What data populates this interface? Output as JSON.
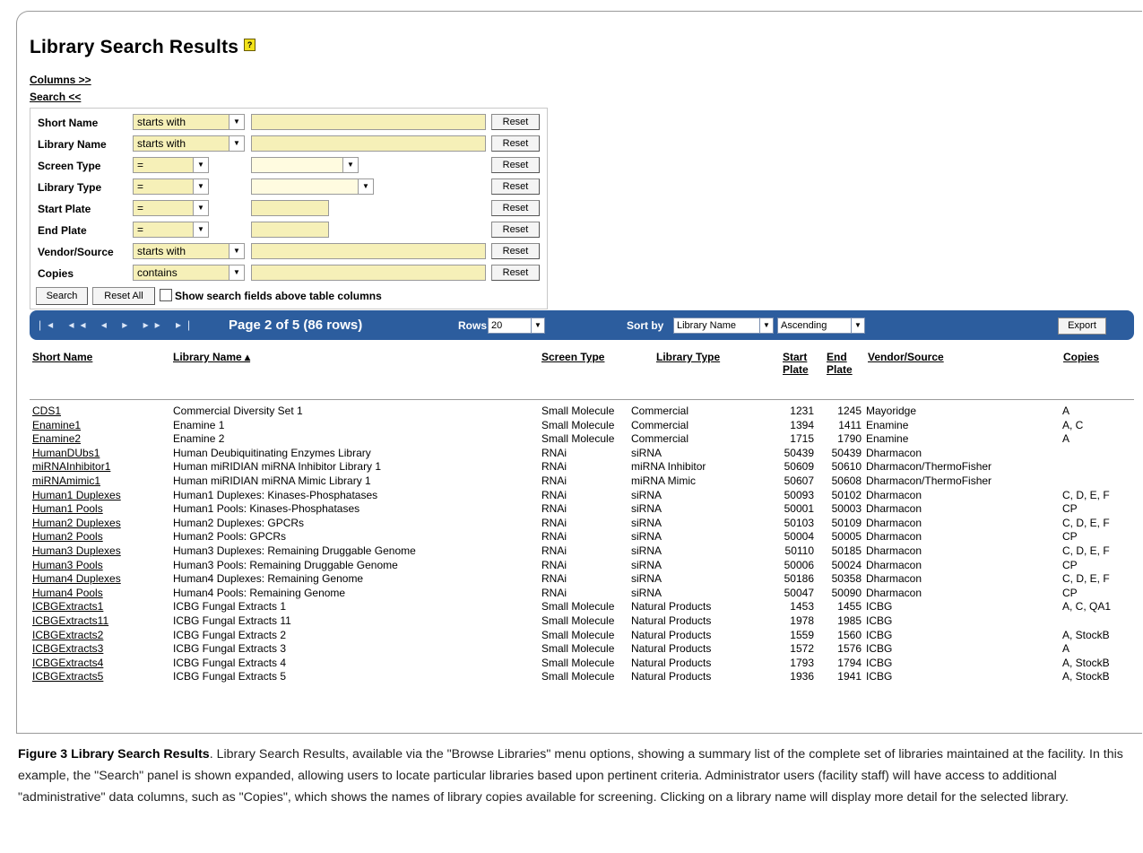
{
  "title": "Library Search Results",
  "help_icon": "help-icon",
  "columns_toggle": "Columns >>",
  "search_toggle": "Search <<",
  "search_fields": [
    {
      "label": "Short Name",
      "operator": "starts with",
      "value": "",
      "reset": "Reset"
    },
    {
      "label": "Library Name",
      "operator": "starts with",
      "value": "",
      "reset": "Reset"
    },
    {
      "label": "Screen Type",
      "operator": "=",
      "value": "",
      "reset": "Reset"
    },
    {
      "label": "Library Type",
      "operator": "=",
      "value": "",
      "reset": "Reset"
    },
    {
      "label": "Start Plate",
      "operator": "=",
      "value": "",
      "reset": "Reset"
    },
    {
      "label": "End Plate",
      "operator": "=",
      "value": "",
      "reset": "Reset"
    },
    {
      "label": "Vendor/Source",
      "operator": "starts with",
      "value": "",
      "reset": "Reset"
    },
    {
      "label": "Copies",
      "operator": "contains",
      "value": "",
      "reset": "Reset"
    }
  ],
  "search_button": "Search",
  "reset_all_button": "Reset All",
  "show_fields_label": "Show search fields above table columns",
  "navbar": {
    "nav_icons": "first, fast-back, back, forward, fast-forward, last",
    "page_info": "Page 2 of 5 (86 rows)",
    "rows_label": "Rows",
    "rows_value": "20",
    "sort_label": "Sort by",
    "sort_field": "Library Name",
    "sort_order": "Ascending",
    "export": "Export"
  },
  "headers": {
    "short_name": "Short Name",
    "library_name": "Library Name ▴",
    "screen_type": "Screen Type",
    "library_type": "Library Type",
    "start_plate_1": "Start",
    "start_plate_2": "Plate",
    "end_plate_1": "End",
    "end_plate_2": "Plate",
    "vendor": "Vendor/Source",
    "copies": "Copies"
  },
  "rows": [
    [
      "CDS1",
      "Commercial Diversity Set 1",
      "Small Molecule",
      "Commercial",
      "1231",
      "1245",
      "Mayoridge",
      "A"
    ],
    [
      "Enamine1",
      "Enamine 1",
      "Small Molecule",
      "Commercial",
      "1394",
      "1411",
      "Enamine",
      "A, C"
    ],
    [
      "Enamine2",
      "Enamine 2",
      "Small Molecule",
      "Commercial",
      "1715",
      "1790",
      "Enamine",
      "A"
    ],
    [
      "HumanDUbs1",
      "Human Deubiquitinating Enzymes Library",
      "RNAi",
      "siRNA",
      "50439",
      "50439",
      "Dharmacon",
      ""
    ],
    [
      "miRNAInhibitor1",
      "Human miRIDIAN miRNA Inhibitor Library 1",
      "RNAi",
      "miRNA Inhibitor",
      "50609",
      "50610",
      "Dharmacon/ThermoFisher",
      ""
    ],
    [
      "miRNAmimic1",
      "Human miRIDIAN miRNA Mimic Library 1",
      "RNAi",
      "miRNA Mimic",
      "50607",
      "50608",
      "Dharmacon/ThermoFisher",
      ""
    ],
    [
      "Human1 Duplexes",
      "Human1 Duplexes: Kinases-Phosphatases",
      "RNAi",
      "siRNA",
      "50093",
      "50102",
      "Dharmacon",
      "C, D, E, F"
    ],
    [
      "Human1 Pools",
      "Human1 Pools: Kinases-Phosphatases",
      "RNAi",
      "siRNA",
      "50001",
      "50003",
      "Dharmacon",
      "CP"
    ],
    [
      "Human2 Duplexes",
      "Human2 Duplexes: GPCRs",
      "RNAi",
      "siRNA",
      "50103",
      "50109",
      "Dharmacon",
      "C, D, E, F"
    ],
    [
      "Human2 Pools",
      "Human2 Pools: GPCRs",
      "RNAi",
      "siRNA",
      "50004",
      "50005",
      "Dharmacon",
      "CP"
    ],
    [
      "Human3 Duplexes",
      "Human3 Duplexes: Remaining Druggable Genome",
      "RNAi",
      "siRNA",
      "50110",
      "50185",
      "Dharmacon",
      "C, D, E, F"
    ],
    [
      "Human3 Pools",
      "Human3 Pools: Remaining Druggable Genome",
      "RNAi",
      "siRNA",
      "50006",
      "50024",
      "Dharmacon",
      "CP"
    ],
    [
      "Human4 Duplexes",
      "Human4 Duplexes: Remaining Genome",
      "RNAi",
      "siRNA",
      "50186",
      "50358",
      "Dharmacon",
      "C, D, E, F"
    ],
    [
      "Human4 Pools",
      "Human4 Pools: Remaining Genome",
      "RNAi",
      "siRNA",
      "50047",
      "50090",
      "Dharmacon",
      "CP"
    ],
    [
      "ICBGExtracts1",
      "ICBG Fungal Extracts 1",
      "Small Molecule",
      "Natural Products",
      "1453",
      "1455",
      "ICBG",
      "A, C, QA1"
    ],
    [
      "ICBGExtracts11",
      "ICBG Fungal Extracts 11",
      "Small Molecule",
      "Natural Products",
      "1978",
      "1985",
      "ICBG",
      ""
    ],
    [
      "ICBGExtracts2",
      "ICBG Fungal Extracts 2",
      "Small Molecule",
      "Natural Products",
      "1559",
      "1560",
      "ICBG",
      "A, StockB"
    ],
    [
      "ICBGExtracts3",
      "ICBG Fungal Extracts 3",
      "Small Molecule",
      "Natural Products",
      "1572",
      "1576",
      "ICBG",
      "A"
    ],
    [
      "ICBGExtracts4",
      "ICBG Fungal Extracts 4",
      "Small Molecule",
      "Natural Products",
      "1793",
      "1794",
      "ICBG",
      "A, StockB"
    ],
    [
      "ICBGExtracts5",
      "ICBG Fungal Extracts 5",
      "Small Molecule",
      "Natural Products",
      "1936",
      "1941",
      "ICBG",
      "A, StockB"
    ]
  ],
  "caption": {
    "label": "Figure 3 Library Search Results",
    "text": ". Library Search Results, available via the \"Browse Libraries\" menu options, showing a summary list of the complete set of libraries maintained at the facility. In this example, the \"Search\" panel is shown expanded, allowing users to locate particular libraries based upon pertinent criteria. Administrator users (facility staff) will have access to additional \"administrative\" data columns, such as \"Copies\", which shows the names of library copies available for screening. Clicking on a library name will display more detail for the selected library."
  }
}
